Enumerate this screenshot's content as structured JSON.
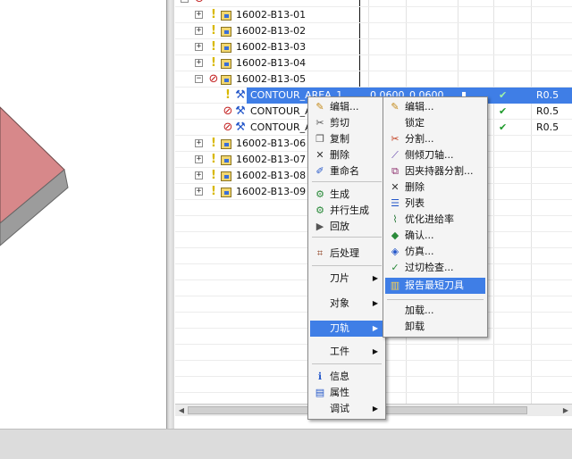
{
  "tree": {
    "rows": [
      {
        "label": "16002-B13-01"
      },
      {
        "label": "16002-B13-02"
      },
      {
        "label": "16002-B13-03"
      },
      {
        "label": "16002-B13-04"
      },
      {
        "label": "16002-B13-05"
      },
      {
        "label": "CONTOUR_AREA_1",
        "v1": "0.0600",
        "v2": "0.0600",
        "tool": "R0.5"
      },
      {
        "label": "CONTOUR_A",
        "tool": "R0.5"
      },
      {
        "label": "CONTOUR_A",
        "tool": "R0.5"
      },
      {
        "label": "16002-B13-06"
      },
      {
        "label": "16002-B13-07"
      },
      {
        "label": "16002-B13-08"
      },
      {
        "label": "16002-B13-09"
      }
    ]
  },
  "context_menu": {
    "items": [
      {
        "label": "编辑..."
      },
      {
        "label": "剪切"
      },
      {
        "label": "复制"
      },
      {
        "label": "删除"
      },
      {
        "label": "重命名"
      },
      {
        "label": "生成"
      },
      {
        "label": "并行生成"
      },
      {
        "label": "回放"
      },
      {
        "label": "后处理"
      },
      {
        "label": "刀片"
      },
      {
        "label": "对象"
      },
      {
        "label": "刀轨"
      },
      {
        "label": "工件"
      },
      {
        "label": "信息"
      },
      {
        "label": "属性"
      },
      {
        "label": "调试"
      }
    ]
  },
  "submenu": {
    "items": [
      {
        "label": "编辑..."
      },
      {
        "label": "锁定"
      },
      {
        "label": "分割..."
      },
      {
        "label": "侧倾刀轴..."
      },
      {
        "label": "因夹持器分割..."
      },
      {
        "label": "删除"
      },
      {
        "label": "列表"
      },
      {
        "label": "优化进给率"
      },
      {
        "label": "确认..."
      },
      {
        "label": "仿真..."
      },
      {
        "label": "过切检查..."
      },
      {
        "label": "报告最短刀具"
      },
      {
        "label": "加载..."
      },
      {
        "label": "卸载"
      }
    ]
  },
  "colors": {
    "selection": "#3f7ee6",
    "part_top": "#d7888a",
    "check": "#1f9a2c"
  }
}
